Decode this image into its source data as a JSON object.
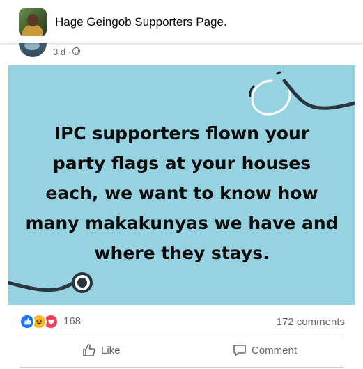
{
  "group": {
    "name": "Hage Geingob Supporters Page."
  },
  "post": {
    "time": "3 d",
    "separator": "·",
    "privacy_icon": "globe-icon",
    "image_text": "IPC supporters flown your party flags at your houses each, we want to know how many makakunyas we have and where they stays.",
    "image_background": "#96d2e0"
  },
  "stats": {
    "reaction_icons": [
      "like-icon",
      "haha-icon",
      "love-icon"
    ],
    "reaction_count": "168",
    "comments": "172 comments"
  },
  "actions": {
    "like_label": "Like",
    "comment_label": "Comment"
  },
  "colors": {
    "like": "#1877f2",
    "haha": "#f7b928",
    "love": "#f33e58",
    "secondary_text": "#65676b"
  }
}
